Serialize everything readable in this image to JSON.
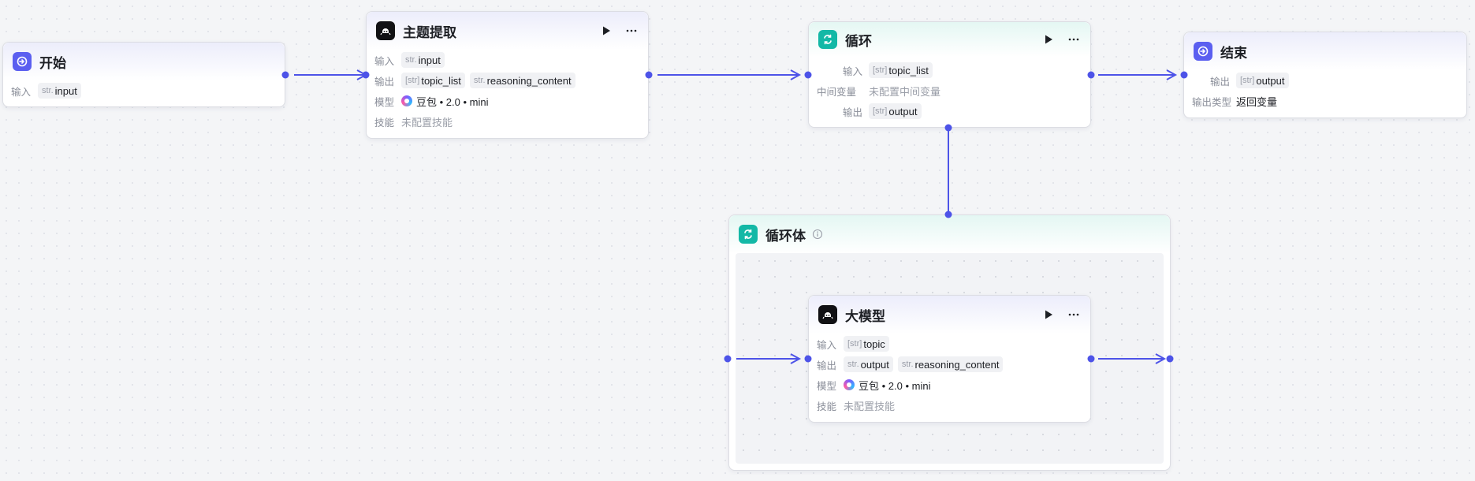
{
  "nodes": {
    "start": {
      "title": "开始",
      "input_label": "输入",
      "input_type": "str.",
      "input_value": "input"
    },
    "topic_extract": {
      "title": "主题提取",
      "input_label": "输入",
      "input_type": "str.",
      "input_value": "input",
      "output_label": "输出",
      "output_tags": [
        {
          "type": "[str]",
          "name": "topic_list"
        },
        {
          "type": "str.",
          "name": "reasoning_content"
        }
      ],
      "model_label": "模型",
      "model_value": "豆包 • 2.0 • mini",
      "skill_label": "技能",
      "skill_value": "未配置技能"
    },
    "loop": {
      "title": "循环",
      "input_label": "输入",
      "input_type": "[str]",
      "input_value": "topic_list",
      "middle_label": "中间变量",
      "middle_value": "未配置中间变量",
      "output_label": "输出",
      "output_type": "[str]",
      "output_value": "output"
    },
    "end": {
      "title": "结束",
      "output_label": "输出",
      "output_type": "[str]",
      "output_value": "output",
      "output_kind_label": "输出类型",
      "output_kind_value": "返回变量"
    },
    "loop_body": {
      "title": "循环体"
    },
    "llm": {
      "title": "大模型",
      "input_label": "输入",
      "input_type": "[str]",
      "input_value": "topic",
      "output_label": "输出",
      "output_tags": [
        {
          "type": "str.",
          "name": "output"
        },
        {
          "type": "str.",
          "name": "reasoning_content"
        }
      ],
      "model_label": "模型",
      "model_value": "豆包 • 2.0 • mini",
      "skill_label": "技能",
      "skill_value": "未配置技能"
    }
  },
  "colors": {
    "edge": "#4d53e8",
    "start_icon": "#5b5ff0",
    "llm_icon": "#111114",
    "loop_icon": "#13b8a6"
  },
  "icons": {
    "start": "enter-icon",
    "end": "exit-icon",
    "llm": "robot-icon",
    "loop": "loop-icon",
    "run": "play-icon",
    "more": "more-dots-icon",
    "info": "info-icon"
  }
}
